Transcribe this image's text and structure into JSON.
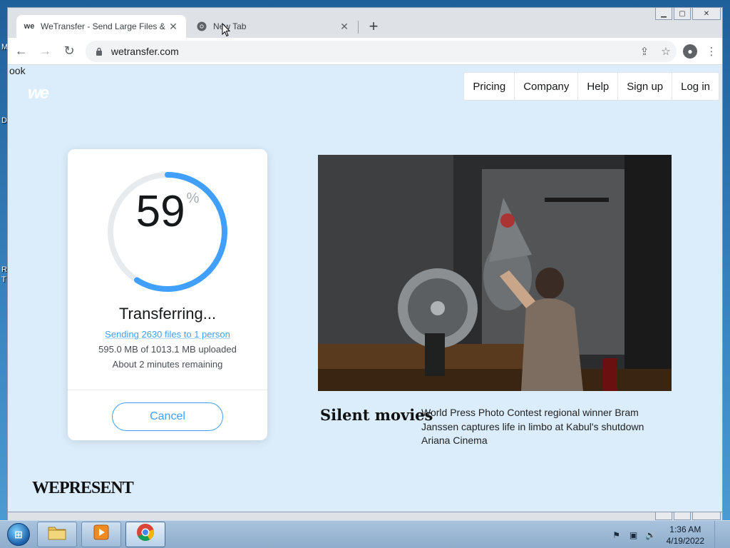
{
  "desktop": {
    "side_labels": [
      "M",
      "D",
      "R",
      "T"
    ]
  },
  "browser": {
    "tabs": [
      {
        "title": "WeTransfer - Send Large Files & Share Photos Online",
        "favicon": "we"
      },
      {
        "title": "New Tab",
        "favicon": "chrome-icon"
      }
    ],
    "url": "wetransfer.com"
  },
  "page": {
    "clipped_text": "ook",
    "logo": "we",
    "nav": [
      "Pricing",
      "Company",
      "Help",
      "Sign up",
      "Log in"
    ],
    "transfer": {
      "percent": 59,
      "percent_symbol": "%",
      "title": "Transferring...",
      "link": "Sending 2630 files to 1 person",
      "progress": "595.0 MB of 1013.1 MB uploaded",
      "remaining": "About 2 minutes remaining",
      "cancel": "Cancel"
    },
    "feature": {
      "title": "Silent movies",
      "description": "World Press Photo Contest regional winner Bram Janssen captures life in limbo at Kabul's shutdown Ariana Cinema"
    },
    "footer_brand": "WEPRESENT"
  },
  "taskbar": {
    "time": "1:36 AM",
    "date": "4/19/2022"
  },
  "colors": {
    "accent": "#409fff",
    "page_bg": "#dbedfb",
    "ring_track": "#e8ebed"
  }
}
